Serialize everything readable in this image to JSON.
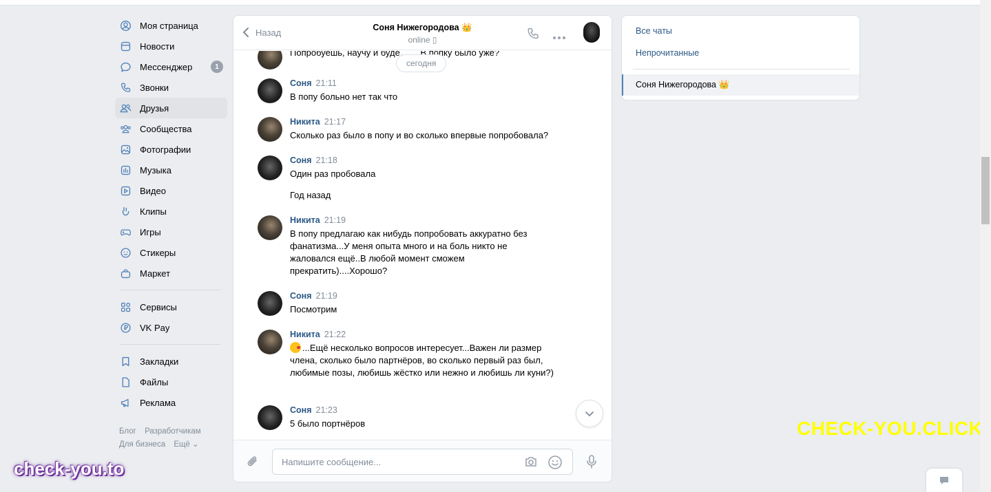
{
  "nav": {
    "items": [
      {
        "label": "Моя страница",
        "icon": "user-circle-icon"
      },
      {
        "label": "Новости",
        "icon": "news-icon"
      },
      {
        "label": "Мессенджер",
        "icon": "message-icon",
        "badge": "1"
      },
      {
        "label": "Звонки",
        "icon": "phone-icon"
      },
      {
        "label": "Друзья",
        "icon": "friends-icon"
      },
      {
        "label": "Сообщества",
        "icon": "communities-icon"
      },
      {
        "label": "Фотографии",
        "icon": "photo-icon"
      },
      {
        "label": "Музыка",
        "icon": "music-icon"
      },
      {
        "label": "Видео",
        "icon": "video-icon"
      },
      {
        "label": "Клипы",
        "icon": "clips-icon"
      },
      {
        "label": "Игры",
        "icon": "gamepad-icon"
      },
      {
        "label": "Стикеры",
        "icon": "sticker-icon"
      },
      {
        "label": "Маркет",
        "icon": "market-bag-icon"
      }
    ],
    "items2": [
      {
        "label": "Сервисы",
        "icon": "services-grid-icon"
      },
      {
        "label": "VK Pay",
        "icon": "vkpay-icon"
      }
    ],
    "items3": [
      {
        "label": "Закладки",
        "icon": "bookmark-icon"
      },
      {
        "label": "Файлы",
        "icon": "file-icon"
      },
      {
        "label": "Реклама",
        "icon": "megaphone-icon"
      }
    ],
    "footer": {
      "blog": "Блог",
      "developers": "Разработчикам",
      "business": "Для бизнеса",
      "more": "Ещё ⌄"
    }
  },
  "chat": {
    "back_label": "Назад",
    "title": "Соня Нижегородова 👑",
    "status": "online ▯",
    "date_pill": "сегодня",
    "input_placeholder": "Напишите сообщение...",
    "messages": [
      {
        "author": "",
        "time": "",
        "lines": [
          "Попробуешь, научу и буде…  …В попку было уже?"
        ]
      },
      {
        "author": "Соня",
        "time": "21:11",
        "lines": [
          "В попу больно нет так что"
        ]
      },
      {
        "author": "Никита",
        "time": "21:17",
        "lines": [
          "Сколько раз было в попу и во сколько впервые попробовала?"
        ]
      },
      {
        "author": "Соня",
        "time": "21:18",
        "lines": [
          "Один раз пробовала",
          "Год назад"
        ]
      },
      {
        "author": "Никита",
        "time": "21:19",
        "lines": [
          "В попу предлагаю как нибудь попробовать аккуратно без фанатизма...У меня опыта много и на боль никто не жаловался ещё..В любой момент сможем прекратить)....Хорошо?"
        ]
      },
      {
        "author": "Соня",
        "time": "21:19",
        "lines": [
          "Посмотрим"
        ]
      },
      {
        "author": "Никита",
        "time": "21:22",
        "lines": [
          "...Ещё несколько вопросов интересует...Важен ли размер члена, сколько было партнёров, во сколько первый раз был, любимые позы, любишь жёстко или нежно и любишь ли куни?)"
        ]
      },
      {
        "author": "Соня",
        "time": "21:23",
        "lines": [
          "5 было портнёров"
        ]
      }
    ]
  },
  "right_panel": {
    "all_chats": "Все чаты",
    "unread": "Непрочитанные",
    "active_chat": "Соня Нижегородова 👑"
  },
  "watermarks": {
    "yellow": "CHECK-YOU.CLICK",
    "purple": "check-you.to"
  },
  "colors": {
    "link": "#2a5885",
    "accent": "#5181b8",
    "muted": "#818c99",
    "background": "#ebedf0"
  }
}
